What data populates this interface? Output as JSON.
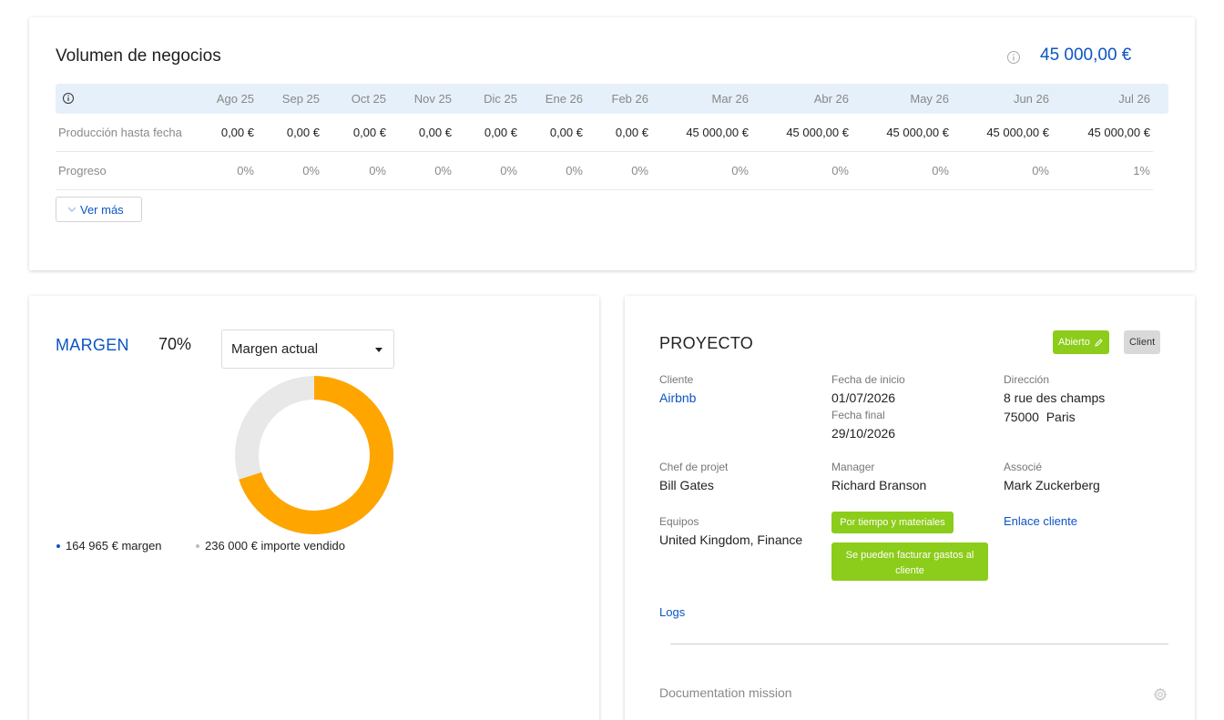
{
  "volume": {
    "title": "Volumen de negocios",
    "total": "45 000,00 €",
    "months": [
      "Ago 25",
      "Sep 25",
      "Oct 25",
      "Nov 25",
      "Dic 25",
      "Ene 26",
      "Feb 26",
      "Mar 26",
      "Abr 26",
      "May 26",
      "Jun 26",
      "Jul 26"
    ],
    "rows": {
      "production": {
        "label": "Producción hasta fecha",
        "values": [
          "0,00 €",
          "0,00 €",
          "0,00 €",
          "0,00 €",
          "0,00 €",
          "0,00 €",
          "0,00 €",
          "45 000,00 €",
          "45 000,00 €",
          "45 000,00 €",
          "45 000,00 €",
          "45 000,00 €"
        ]
      },
      "progress": {
        "label": "Progreso",
        "values": [
          "0%",
          "0%",
          "0%",
          "0%",
          "0%",
          "0%",
          "0%",
          "0%",
          "0%",
          "0%",
          "0%",
          "1%"
        ]
      }
    },
    "more_label": "Ver más"
  },
  "margin": {
    "title": "MARGEN",
    "percent": "70%",
    "select_value": "Margen actual",
    "legend_margin": "164 965 € margen",
    "legend_sold": "236 000 € importe vendido",
    "chart_data": {
      "type": "pie",
      "slices": [
        {
          "label": "margen",
          "value": 164965
        },
        {
          "label": "importe vendido",
          "value": 236000
        }
      ],
      "fill_fraction": 0.7,
      "colors": {
        "fill": "#ffa500",
        "track": "#e8e8e8"
      }
    }
  },
  "project": {
    "title": "PROYECTO",
    "status_badge": "Abierto",
    "client_badge": "Client",
    "client_label": "Cliente",
    "client_value": "Airbnb",
    "start_label": "Fecha de inicio",
    "start_value": "01/07/2026",
    "end_label": "Fecha final",
    "end_value": "29/10/2026",
    "address_label": "Dirección",
    "address_line1": "8 rue des champs",
    "address_line2": "75000  Paris",
    "chef_label": "Chef de projet",
    "chef_value": "Bill Gates",
    "manager_label": "Manager",
    "manager_value": "Richard Branson",
    "associe_label": "Associé",
    "associe_value": "Mark Zuckerberg",
    "teams_label": "Equipos",
    "teams_value": "United Kingdom, Finance",
    "tag_time": "Por tiempo y materiales",
    "tag_expenses": "Se pueden facturar gastos al cliente",
    "client_link": "Enlace cliente",
    "logs_link": "Logs",
    "doc_title": "Documentation mission"
  },
  "colors": {
    "accent": "#0b55c4",
    "green": "#8ccc1a",
    "orange": "#ffa500"
  }
}
